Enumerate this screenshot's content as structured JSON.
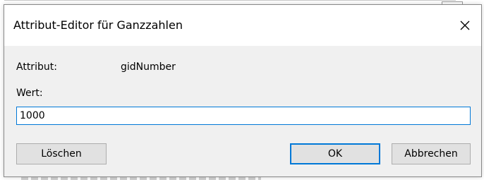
{
  "dialog": {
    "title": "Attribut-Editor für Ganzzahlen",
    "close_icon": "close-icon"
  },
  "form": {
    "attribute_label": "Attribut:",
    "attribute_value": "gidNumber",
    "value_label": "Wert:",
    "value_input": "1000"
  },
  "buttons": {
    "clear": "Löschen",
    "ok": "OK",
    "cancel": "Abbrechen"
  },
  "colors": {
    "accent": "#0078d7",
    "dialog_bg": "#f0f0f0",
    "titlebar_bg": "#ffffff",
    "button_bg": "#e1e1e1"
  }
}
